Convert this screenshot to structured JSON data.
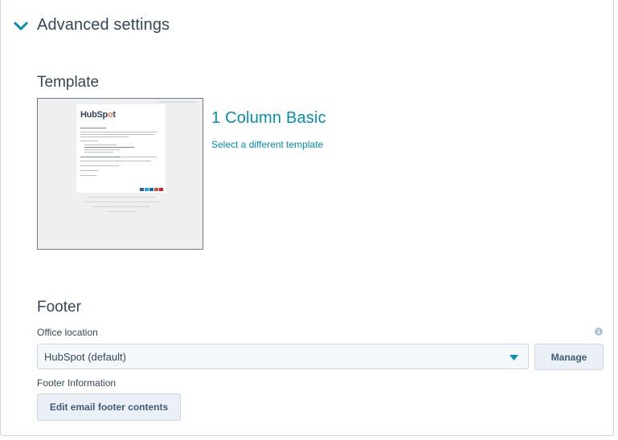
{
  "advanced": {
    "title": "Advanced settings",
    "icon": "chevron-down-icon",
    "accent": "#0091ae"
  },
  "template": {
    "heading": "Template",
    "name": "1 Column Basic",
    "change_link": "Select a different template",
    "thumbnail_logo": "HubSpot"
  },
  "footer": {
    "heading": "Footer",
    "office_location_label": "Office location",
    "office_location_value": "HubSpot (default)",
    "manage_label": "Manage",
    "footer_info_label": "Footer Information",
    "edit_button_label": "Edit email footer contents",
    "info_icon": "info-icon"
  }
}
